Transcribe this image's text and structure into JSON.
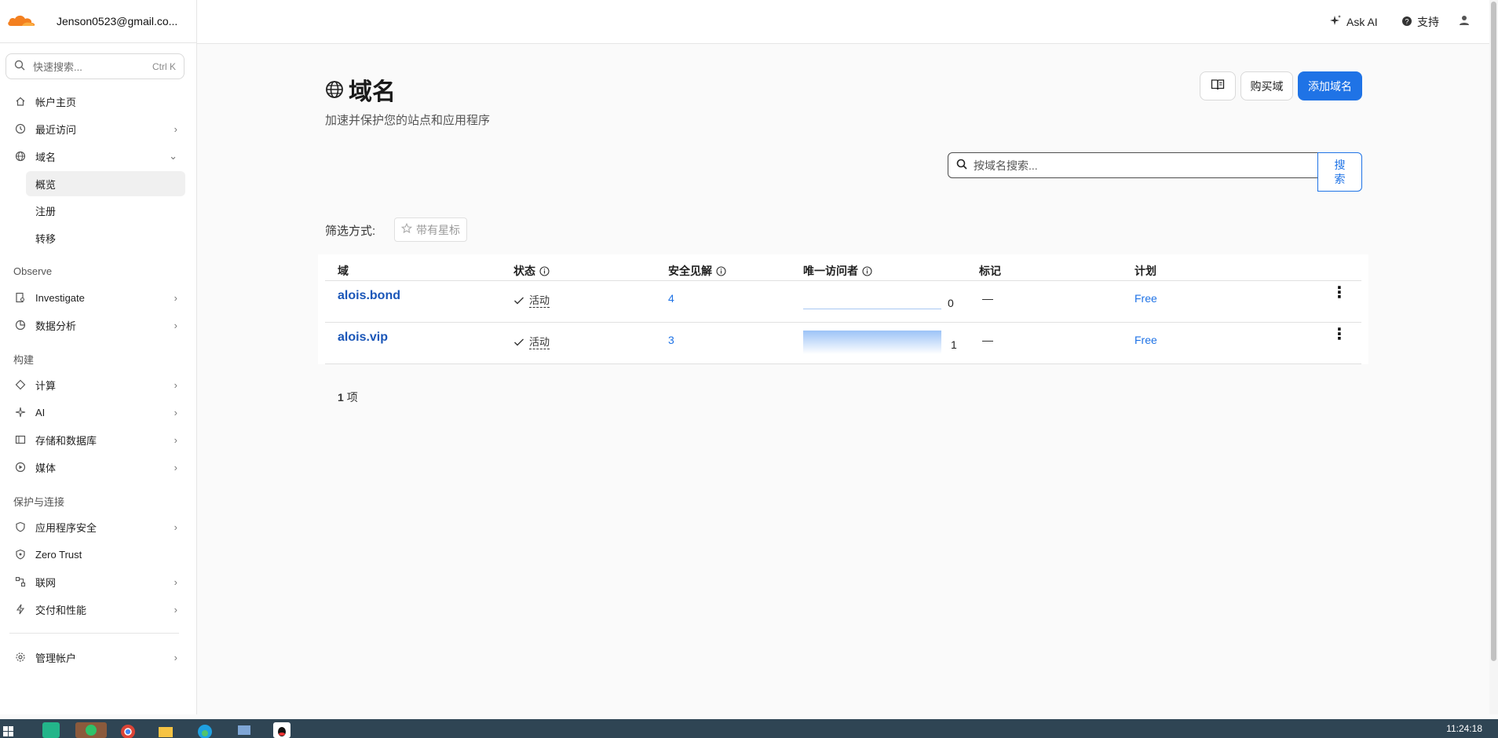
{
  "account": {
    "email": "Jenson0523@gmail.co..."
  },
  "sidebar": {
    "search_placeholder": "快速搜索...",
    "search_shortcut": "Ctrl K",
    "items": [
      {
        "label": "帐户主页",
        "icon": "home-icon"
      },
      {
        "label": "最近访问",
        "icon": "clock-icon"
      },
      {
        "label": "域名",
        "icon": "globe-icon"
      }
    ],
    "sub_items": [
      "概览",
      "注册",
      "转移"
    ],
    "sections": {
      "observe": "Observe",
      "build": "构建",
      "protect": "保护与连接"
    },
    "observe_items": [
      {
        "label": "Investigate",
        "icon": "document-search-icon"
      },
      {
        "label": "数据分析",
        "icon": "chart-pie-icon"
      }
    ],
    "build_items": [
      {
        "label": "计算",
        "icon": "diamond-icon"
      },
      {
        "label": "AI",
        "icon": "sparkle-icon"
      },
      {
        "label": "存储和数据库",
        "icon": "database-icon"
      },
      {
        "label": "媒体",
        "icon": "play-icon"
      }
    ],
    "protect_items": [
      {
        "label": "应用程序安全",
        "icon": "shield-icon"
      },
      {
        "label": "Zero Trust",
        "icon": "shield-lock-icon"
      },
      {
        "label": "联网",
        "icon": "network-icon"
      },
      {
        "label": "交付和性能",
        "icon": "bolt-icon"
      }
    ],
    "manage": {
      "label": "管理帐户",
      "icon": "gear-icon"
    }
  },
  "topbar": {
    "ask_ai": "Ask AI",
    "support": "支持"
  },
  "page": {
    "title": "域名",
    "subtitle": "加速并保护您的站点和应用程序",
    "buy_domain": "购买域",
    "add_domain": "添加域名",
    "search_placeholder": "按域名搜索...",
    "search_button": "搜索",
    "filter_label": "筛选方式:",
    "filter_starred": "带有星标"
  },
  "table": {
    "columns": [
      "域",
      "状态",
      "安全见解",
      "唯一访问者",
      "标记",
      "计划"
    ],
    "rows": [
      {
        "domain": "alois.bond",
        "status": "活动",
        "insights": "4",
        "visitors": "0",
        "visitors_fraction": 0,
        "tags": "—",
        "plan": "Free"
      },
      {
        "domain": "alois.vip",
        "status": "活动",
        "insights": "3",
        "visitors": "1",
        "visitors_fraction": 1,
        "tags": "—",
        "plan": "Free"
      }
    ],
    "count_num": "1",
    "count_unit": "项"
  },
  "taskbar": {
    "time": "11:24:18"
  },
  "colors": {
    "brand_orange": "#f38020",
    "primary_blue": "#1f73e6",
    "link_blue": "#1a56b8"
  }
}
